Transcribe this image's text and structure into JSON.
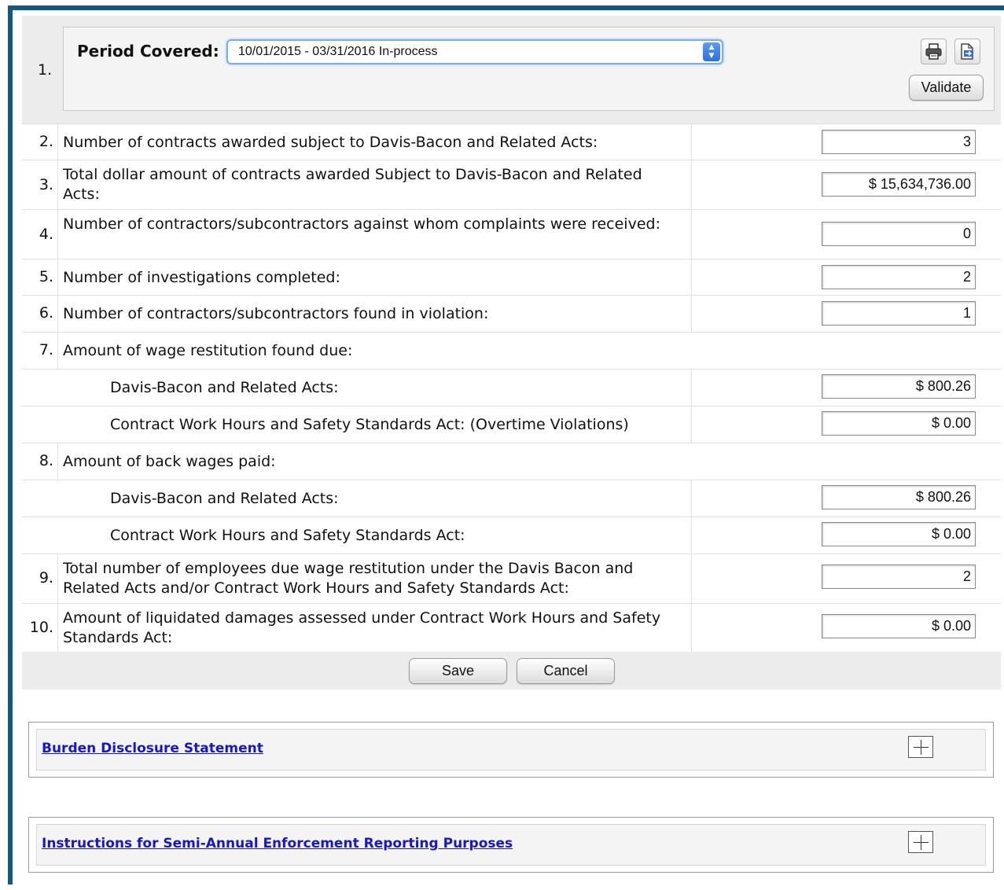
{
  "period": {
    "num": "1.",
    "label": "Period Covered:",
    "selected": "10/01/2015 - 03/31/2016 In-process",
    "validate_label": "Validate"
  },
  "rows": [
    {
      "num": "2.",
      "label": "Number of contracts awarded subject to Davis-Bacon and Related Acts:",
      "value": "3"
    },
    {
      "num": "3.",
      "label": "Total dollar amount of contracts awarded Subject to Davis-Bacon and Related Acts:",
      "value": "$ 15,634,736.00"
    },
    {
      "num": "4.",
      "label": "Number of contractors/subcontractors against whom complaints were received:",
      "value": "0"
    },
    {
      "num": "5.",
      "label": "Number of investigations completed:",
      "value": "2"
    },
    {
      "num": "6.",
      "label": "Number of contractors/subcontractors found in violation:",
      "value": "1"
    },
    {
      "num": "7.",
      "label": "Amount of wage restitution found due:"
    },
    {
      "label": "Davis-Bacon and Related Acts:",
      "value": "$ 800.26"
    },
    {
      "label": "Contract Work Hours and Safety Standards Act: (Overtime Violations)",
      "value": "$ 0.00"
    },
    {
      "num": "8.",
      "label": "Amount of back wages paid:"
    },
    {
      "label": "Davis-Bacon and Related Acts:",
      "value": "$ 800.26"
    },
    {
      "label": "Contract Work Hours and Safety Standards Act:",
      "value": "$ 0.00"
    },
    {
      "num": "9.",
      "label": "Total number of employees due wage restitution under the Davis Bacon and Related Acts and/or Contract Work Hours and Safety Standards Act:",
      "value": "2"
    },
    {
      "num": "10.",
      "label": "Amount of liquidated damages assessed under Contract Work Hours and Safety Standards Act:",
      "value": "$ 0.00"
    }
  ],
  "actions": {
    "save_label": "Save",
    "cancel_label": "Cancel"
  },
  "panels": [
    {
      "title": "Burden Disclosure Statement"
    },
    {
      "title": "Instructions for Semi-Annual Enforcement Reporting Purposes"
    }
  ],
  "colors": {
    "frame": "#0f5a83",
    "link": "#1515d6",
    "select_focus": "#7aaef0"
  }
}
